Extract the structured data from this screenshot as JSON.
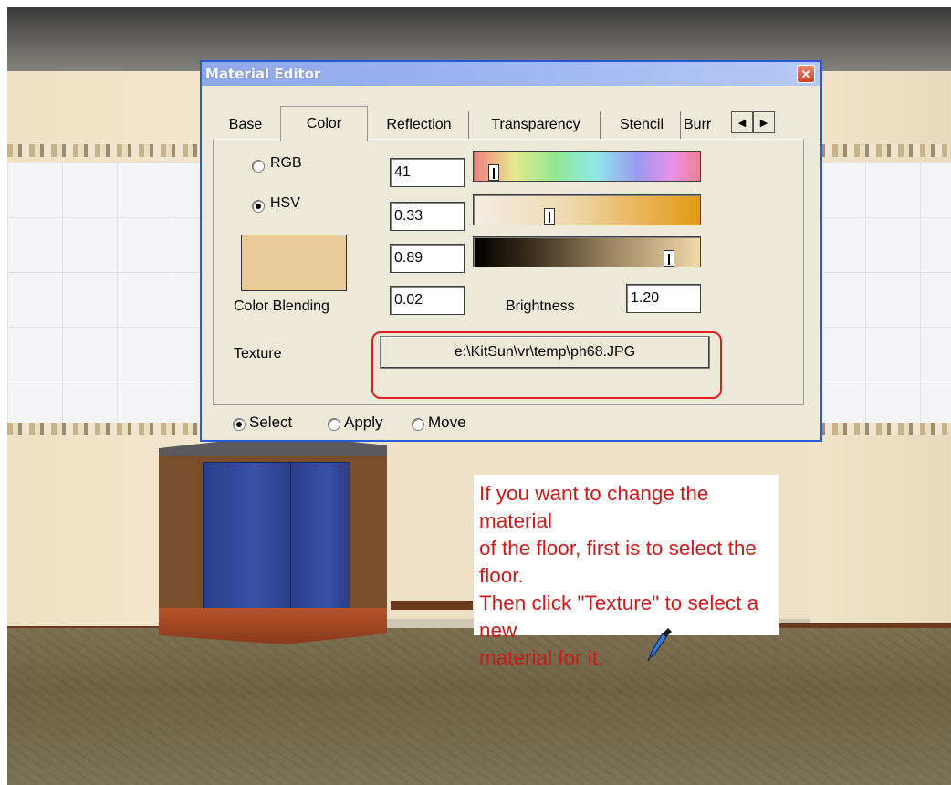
{
  "window": {
    "title": "Material Editor",
    "close_glyph": "✕"
  },
  "tabs": [
    {
      "label": "Base"
    },
    {
      "label": "Color"
    },
    {
      "label": "Reflection"
    },
    {
      "label": "Transparency"
    },
    {
      "label": "Stencil"
    },
    {
      "label": "Burr"
    }
  ],
  "tab_scroll": {
    "left": "◀",
    "right": "▶"
  },
  "color_mode": {
    "rgb_label": "RGB",
    "hsv_label": "HSV",
    "selected": "HSV"
  },
  "channels": [
    {
      "value": "41",
      "slider": "hue",
      "level": 0.07
    },
    {
      "value": "0.33",
      "slider": "saturation",
      "level": 0.33
    },
    {
      "value": "0.89",
      "slider": "value",
      "level": 0.89
    }
  ],
  "swatch_color": "#e8cb98",
  "color_blending": {
    "label": "Color Blending",
    "value": "0.02"
  },
  "brightness": {
    "label": "Brightness",
    "value": "1.20"
  },
  "texture": {
    "label": "Texture",
    "path": "e:\\KitSun\\vr\\temp\\ph68.JPG"
  },
  "modes": {
    "options": [
      "Select",
      "Apply",
      "Move"
    ],
    "selected": "Select"
  },
  "note": {
    "lines": [
      "If you want to change the material",
      "of the floor, first is to select the floor.",
      "Then click \"Texture\" to select a new",
      "material for it."
    ],
    "color": "#cc1a1a"
  },
  "colors": {
    "highlight": "#e02020",
    "title_bar": "#9ab2f0",
    "window_bg": "#ece9d8"
  }
}
